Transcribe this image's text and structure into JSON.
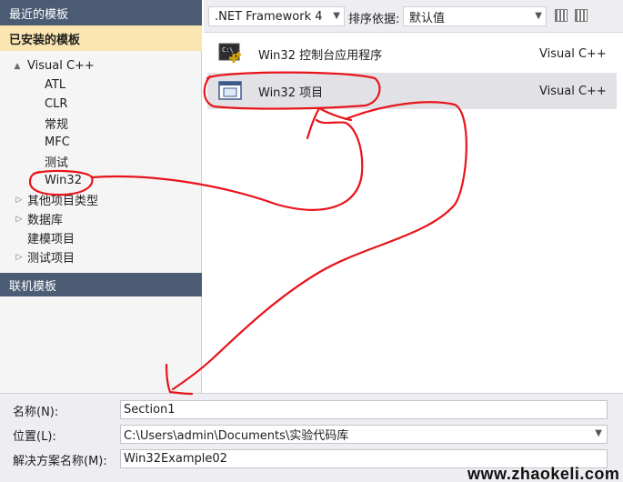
{
  "left_panel": {
    "recent_header": "最近的模板",
    "installed_header": "已安装的模板",
    "online_header": "联机模板",
    "tree": [
      {
        "label": "Visual C++",
        "arrow": "▲"
      },
      {
        "label": "ATL"
      },
      {
        "label": "CLR"
      },
      {
        "label": "常规"
      },
      {
        "label": "MFC"
      },
      {
        "label": "测试"
      },
      {
        "label": "Win32"
      },
      {
        "label": "其他项目类型",
        "arrow": "▷"
      },
      {
        "label": "数据库",
        "arrow": "▷"
      },
      {
        "label": "建模项目"
      },
      {
        "label": "测试项目",
        "arrow": "▷"
      }
    ]
  },
  "toolbar": {
    "framework_value": ".NET Framework 4",
    "sort_label": "排序依据:",
    "sort_value": "默认值"
  },
  "templates": [
    {
      "name": "Win32 控制台应用程序",
      "lang": "Visual C++",
      "icon": "console-app-icon"
    },
    {
      "name": "Win32 项目",
      "lang": "Visual C++",
      "icon": "window-project-icon"
    }
  ],
  "form": {
    "name_label": "名称(N):",
    "name_value": "Section1",
    "location_label": "位置(L):",
    "location_value": "C:\\Users\\admin\\Documents\\实验代码库",
    "solution_label": "解决方案名称(M):",
    "solution_value": "Win32Example02"
  },
  "watermark": "www.zhaokeli.com",
  "colors": {
    "header_bg": "#4b5c74",
    "installed_bg": "#fbe6b1",
    "annotation_red": "#e8141b"
  }
}
